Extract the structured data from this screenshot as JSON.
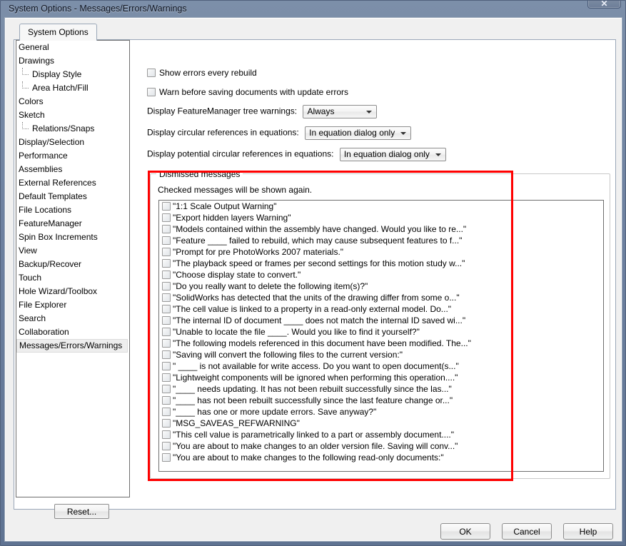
{
  "window": {
    "title": "System Options - Messages/Errors/Warnings",
    "close_label": "✕"
  },
  "tabs": [
    {
      "label": "System Options",
      "selected": true
    }
  ],
  "sidebar": {
    "items": [
      {
        "label": "General",
        "level": 0,
        "selected": false
      },
      {
        "label": "Drawings",
        "level": 0,
        "selected": false
      },
      {
        "label": "Display Style",
        "level": 1,
        "selected": false
      },
      {
        "label": "Area Hatch/Fill",
        "level": 1,
        "selected": false
      },
      {
        "label": "Colors",
        "level": 0,
        "selected": false
      },
      {
        "label": "Sketch",
        "level": 0,
        "selected": false
      },
      {
        "label": "Relations/Snaps",
        "level": 1,
        "selected": false
      },
      {
        "label": "Display/Selection",
        "level": 0,
        "selected": false
      },
      {
        "label": "Performance",
        "level": 0,
        "selected": false
      },
      {
        "label": "Assemblies",
        "level": 0,
        "selected": false
      },
      {
        "label": "External References",
        "level": 0,
        "selected": false
      },
      {
        "label": "Default Templates",
        "level": 0,
        "selected": false
      },
      {
        "label": "File Locations",
        "level": 0,
        "selected": false
      },
      {
        "label": "FeatureManager",
        "level": 0,
        "selected": false
      },
      {
        "label": "Spin Box Increments",
        "level": 0,
        "selected": false
      },
      {
        "label": "View",
        "level": 0,
        "selected": false
      },
      {
        "label": "Backup/Recover",
        "level": 0,
        "selected": false
      },
      {
        "label": "Touch",
        "level": 0,
        "selected": false
      },
      {
        "label": "Hole Wizard/Toolbox",
        "level": 0,
        "selected": false
      },
      {
        "label": "File Explorer",
        "level": 0,
        "selected": false
      },
      {
        "label": "Search",
        "level": 0,
        "selected": false
      },
      {
        "label": "Collaboration",
        "level": 0,
        "selected": false
      },
      {
        "label": "Messages/Errors/Warnings",
        "level": 0,
        "selected": true
      }
    ],
    "reset_label": "Reset..."
  },
  "options": {
    "checkboxes": [
      {
        "label": "Show errors every rebuild",
        "checked": false
      },
      {
        "label": "Warn before saving documents with update errors",
        "checked": false
      }
    ],
    "dropdowns": [
      {
        "label": "Display FeatureManager tree warnings:",
        "value": "Always"
      },
      {
        "label": "Display circular references in equations:",
        "value": "In equation dialog only"
      },
      {
        "label": "Display potential circular references in equations:",
        "value": "In equation dialog only"
      }
    ]
  },
  "dismissed": {
    "legend": "Dismissed messages",
    "hint": "Checked messages will be shown again.",
    "messages": [
      {
        "label": "\"1:1 Scale Output Warning\"",
        "checked": false
      },
      {
        "label": "\"Export hidden layers Warning\"",
        "checked": false
      },
      {
        "label": "\"Models contained within the assembly have changed.  Would you like to re...\"",
        "checked": false
      },
      {
        "label": "\"Feature ____ failed to rebuild, which may cause subsequent features to f...\"",
        "checked": false
      },
      {
        "label": "\"Prompt for pre PhotoWorks 2007 materials.\"",
        "checked": false
      },
      {
        "label": "\"The playback speed or frames per second settings for this motion study w...\"",
        "checked": false
      },
      {
        "label": "\"Choose display state to convert.\"",
        "checked": false
      },
      {
        "label": "\"Do you really want to delete the following item(s)?\"",
        "checked": false
      },
      {
        "label": "\"SolidWorks has detected that the units of the drawing differ from some o...\"",
        "checked": false
      },
      {
        "label": "\"The cell value is linked to a property in a read-only external model. Do...\"",
        "checked": false
      },
      {
        "label": "\"The internal ID of document ____ does not match the internal ID saved wi...\"",
        "checked": false
      },
      {
        "label": "\"Unable to locate the file ____.  Would you like to find it yourself?\"",
        "checked": false
      },
      {
        "label": "\"The following models referenced in this document have been modified. The...\"",
        "checked": false
      },
      {
        "label": "\"Saving will convert the following files to the current version:\"",
        "checked": false
      },
      {
        "label": "\" ____ is not available for write access.  Do you want to open document(s...\"",
        "checked": false
      },
      {
        "label": "\"Lightweight components will be ignored when performing this operation....\"",
        "checked": false
      },
      {
        "label": "\"____ needs updating.  It has not been rebuilt successfully since the las...\"",
        "checked": false
      },
      {
        "label": "\"____ has not been rebuilt successfully since the last feature change or...\"",
        "checked": false
      },
      {
        "label": "\"____ has one or more update errors.  Save anyway?\"",
        "checked": false
      },
      {
        "label": "\"MSG_SAVEAS_REFWARNING\"",
        "checked": false
      },
      {
        "label": "\"This cell value is parametrically linked to a part or assembly document....\"",
        "checked": false
      },
      {
        "label": "\"You are about to make changes to an older version file. Saving will conv...\"",
        "checked": false
      },
      {
        "label": "\"You are about to make changes to the following read-only documents:\"",
        "checked": false
      }
    ]
  },
  "footer": {
    "ok_label": "OK",
    "cancel_label": "Cancel",
    "help_label": "Help"
  },
  "annotation": {
    "highlight_color": "#ff0000"
  }
}
